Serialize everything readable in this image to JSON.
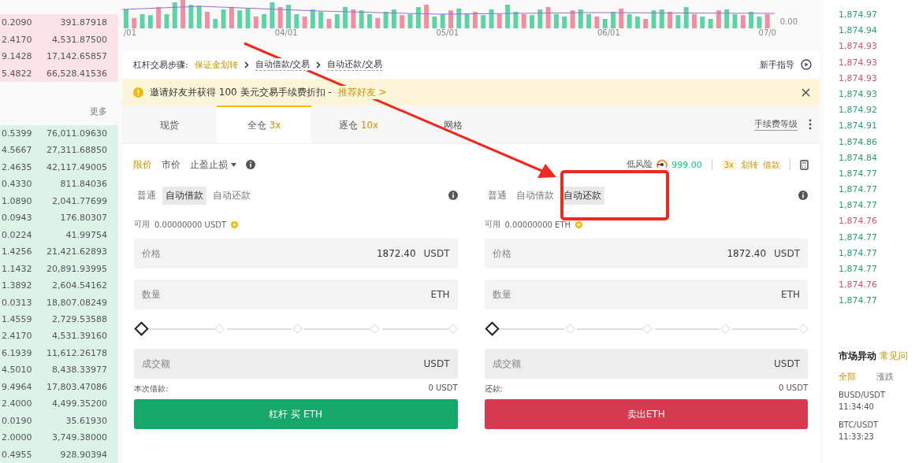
{
  "order_book": {
    "asks": [
      {
        "amount": "0.2090",
        "total": "391.87918"
      },
      {
        "amount": "2.4170",
        "total": "4,531.87500"
      },
      {
        "amount": "9.1428",
        "total": "17,142.65857"
      },
      {
        "amount": "5.4822",
        "total": "66,528.41536"
      }
    ],
    "more_link": "更多",
    "bids": [
      {
        "amount": "0.5399",
        "total": "76,011.09630"
      },
      {
        "amount": "4.5667",
        "total": "27,311.68850"
      },
      {
        "amount": "2.4635",
        "total": "42,117.49005"
      },
      {
        "amount": "0.4330",
        "total": "811.84036"
      },
      {
        "amount": "1.0890",
        "total": "2,041.77699"
      },
      {
        "amount": "0.0943",
        "total": "176.80307"
      },
      {
        "amount": "0.0224",
        "total": "41.99754"
      },
      {
        "amount": "1.4256",
        "total": "21,421.62893"
      },
      {
        "amount": "1.1432",
        "total": "20,891.93995"
      },
      {
        "amount": "1.3892",
        "total": "2,604.54162"
      },
      {
        "amount": "0.0313",
        "total": "18,807.08249"
      },
      {
        "amount": "1.4559",
        "total": "2,729.53588"
      },
      {
        "amount": "2.4170",
        "total": "4,531.39160"
      },
      {
        "amount": "6.1939",
        "total": "11,612.26178"
      },
      {
        "amount": "4.5010",
        "total": "8,438.33977"
      },
      {
        "amount": "9.4964",
        "total": "17,803.47086"
      },
      {
        "amount": "2.4000",
        "total": "4,499.35200"
      },
      {
        "amount": "0.0190",
        "total": "35.61930"
      },
      {
        "amount": "2.0000",
        "total": "3,749.38000"
      },
      {
        "amount": "0.4955",
        "total": "928.90394"
      }
    ]
  },
  "volume_chart": {
    "x_labels": [
      "/01",
      "04/01",
      "05/01",
      "06/01",
      "07/0"
    ],
    "y_labels": [
      "0.00"
    ]
  },
  "steps": {
    "label": "杠杆交易步骤:",
    "items": [
      {
        "text": "保证金划转",
        "kind": "link"
      },
      {
        "text": "自动借款/交易",
        "kind": "step"
      },
      {
        "text": "自动还款/交易",
        "kind": "step"
      }
    ],
    "guide": "新手指导"
  },
  "banner": {
    "text": "邀请好友并获得 100 美元交易手续费折扣 -",
    "link": "推荐好友 >"
  },
  "tabs": [
    {
      "label": "现货",
      "selected": false
    },
    {
      "label": "全仓",
      "leverage": "3x",
      "selected": true
    },
    {
      "label": "逐仓",
      "leverage": "10x",
      "selected": false
    },
    {
      "label": "网格",
      "selected": false
    }
  ],
  "fee_level": "手续费等级",
  "order_types": [
    {
      "label": "限价",
      "selected": true
    },
    {
      "label": "市价",
      "selected": false
    },
    {
      "label": "止盈止损",
      "selected": false,
      "dropdown": true
    }
  ],
  "risk": {
    "label": "低风险",
    "value": "999.00",
    "leverage": "3x",
    "actions": [
      "划转",
      "借款"
    ]
  },
  "forms": [
    {
      "modes": [
        {
          "label": "普通",
          "selected": false
        },
        {
          "label": "自动借款",
          "selected": true
        },
        {
          "label": "自动还款",
          "selected": false
        }
      ],
      "available_label": "可用",
      "available": "0.00000000 USDT",
      "fields": [
        {
          "label": "价格",
          "value": "1872.40",
          "unit": "USDT"
        },
        {
          "label": "数量",
          "unit": "ETH"
        }
      ],
      "slider": {
        "level": 0
      },
      "total": {
        "label": "成交额",
        "unit": "USDT"
      },
      "footer_label": "本次借款:",
      "footer_value": "0 USDT",
      "button": {
        "text": "杠杆 买 ETH",
        "kind": "buy"
      }
    },
    {
      "modes": [
        {
          "label": "普通",
          "selected": false
        },
        {
          "label": "自动借款",
          "selected": false
        },
        {
          "label": "自动还款",
          "selected": true
        }
      ],
      "available_label": "可用",
      "available": "0.00000000 ETH",
      "fields": [
        {
          "label": "价格",
          "value": "1872.40",
          "unit": "USDT"
        },
        {
          "label": "数量",
          "unit": "ETH"
        }
      ],
      "slider": {
        "level": 0
      },
      "total": {
        "label": "成交额",
        "unit": "USDT"
      },
      "footer_label": "还款:",
      "footer_value": "0 USDT",
      "button": {
        "text": "卖出ETH",
        "kind": "sell"
      }
    }
  ],
  "trades": [
    {
      "price": "1,874.97",
      "color": "#2e9e72"
    },
    {
      "price": "1,874.94",
      "color": "#2e9e72"
    },
    {
      "price": "1,874.93",
      "color": "#d0566c"
    },
    {
      "price": "1,874.93",
      "color": "#d0566c"
    },
    {
      "price": "1,874.93",
      "color": "#d0566c"
    },
    {
      "price": "1,874.93",
      "color": "#2e9e72"
    },
    {
      "price": "1,874.92",
      "color": "#2e9e72"
    },
    {
      "price": "1,874.91",
      "color": "#2e9e72"
    },
    {
      "price": "1,874.86",
      "color": "#2e9e72"
    },
    {
      "price": "1,874.84",
      "color": "#2e9e72"
    },
    {
      "price": "1,874.77",
      "color": "#2e9e72"
    },
    {
      "price": "1,874.77",
      "color": "#2e9e72"
    },
    {
      "price": "1,874.77",
      "color": "#2e9e72"
    },
    {
      "price": "1,874.76",
      "color": "#d0566c"
    },
    {
      "price": "1,874.77",
      "color": "#2e9e72"
    },
    {
      "price": "1,874.77",
      "color": "#2e9e72"
    },
    {
      "price": "1,874.77",
      "color": "#2e9e72"
    },
    {
      "price": "1,874.76",
      "color": "#d0566c"
    },
    {
      "price": "1,874.77",
      "color": "#2e9e72"
    }
  ],
  "market_moves": {
    "title": "市场异动",
    "faq": "常见问",
    "tabs": [
      {
        "label": "全部",
        "selected": true
      },
      {
        "label": "涨跌",
        "selected": false
      }
    ],
    "items": [
      {
        "pair": "BUSD/USDT",
        "time": "11:34:40"
      },
      {
        "pair": "BTC/USDT",
        "time": "11:33:23"
      }
    ]
  }
}
